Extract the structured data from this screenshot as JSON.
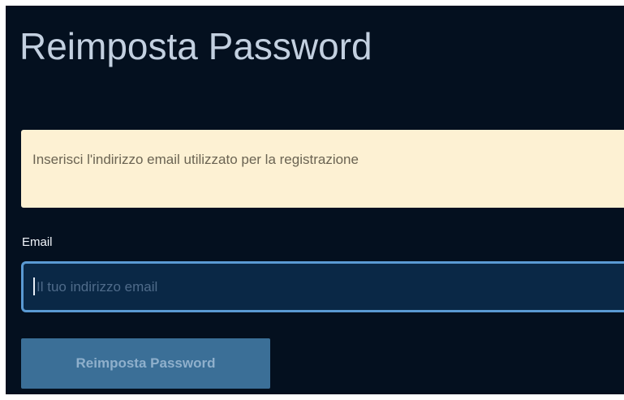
{
  "page": {
    "title": "Reimposta Password"
  },
  "notice": {
    "text": "Inserisci l'indirizzo email utilizzato per la registrazione"
  },
  "form": {
    "email_label": "Email",
    "email_placeholder": "Il tuo indirizzo email",
    "email_value": "",
    "submit_label": "Reimposta Password"
  },
  "colors": {
    "background": "#04101f",
    "title_text": "#c3d0e0",
    "notice_background": "#fdf1d3",
    "notice_text": "#6b6453",
    "input_background": "#0a2846",
    "input_border_focus": "#5a9ad3",
    "button_background": "#3b6f97",
    "button_text": "#8fb0cc"
  }
}
